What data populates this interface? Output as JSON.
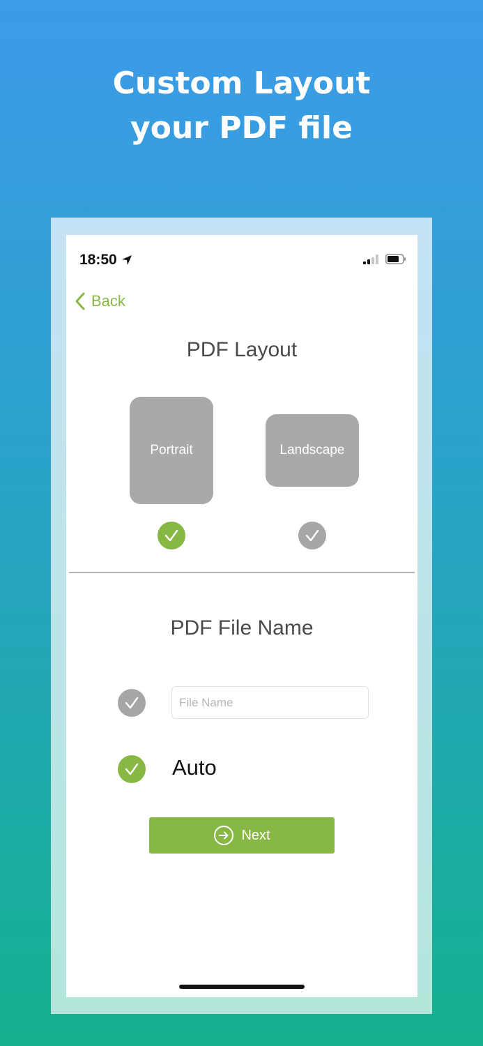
{
  "hero": {
    "title_line1": "Custom Layout",
    "title_line2": "your PDF file"
  },
  "status_bar": {
    "time": "18:50",
    "location_icon": "location-arrow-icon",
    "signal_icon": "cellular-signal-icon",
    "battery_icon": "battery-icon"
  },
  "nav": {
    "back_label": "Back",
    "back_icon": "chevron-left-icon"
  },
  "layout_section": {
    "title": "PDF Layout",
    "options": [
      {
        "label": "Portrait",
        "selected": true
      },
      {
        "label": "Landscape",
        "selected": false
      }
    ]
  },
  "file_name_section": {
    "title": "PDF File Name",
    "input_placeholder": "File Name",
    "input_value": "",
    "custom_selected": false,
    "auto_label": "Auto",
    "auto_selected": true
  },
  "next_button": {
    "label": "Next",
    "icon": "arrow-right-circle-icon"
  },
  "colors": {
    "accent_green": "#88b844",
    "inactive_gray": "#a6a6a6",
    "card_gray": "#a9a9a9"
  }
}
